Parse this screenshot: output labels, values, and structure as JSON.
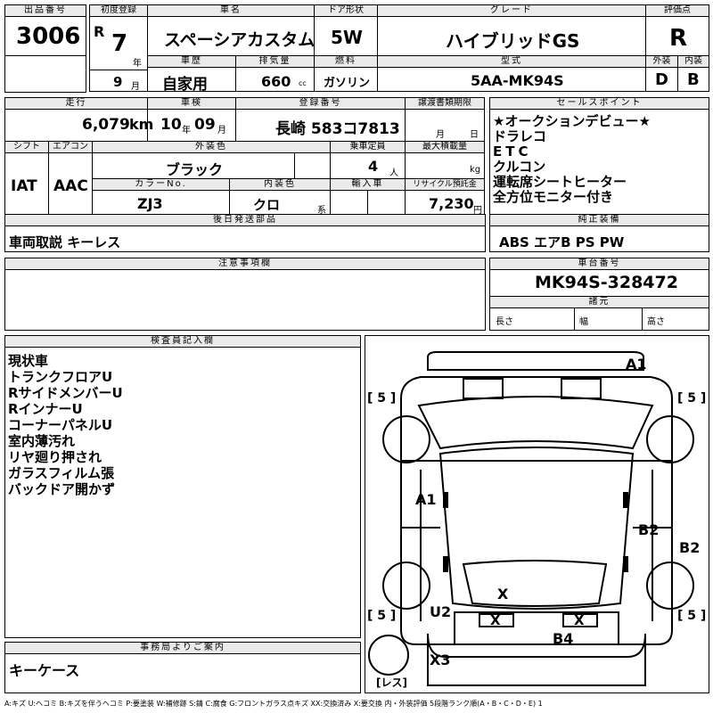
{
  "labels": {
    "lot": "出品番号",
    "first_reg": "初度登録",
    "car_name": "車名",
    "door": "ドア形状",
    "grade": "グレード",
    "score": "評価点",
    "history": "車歴",
    "displacement": "排気量",
    "fuel": "燃料",
    "model_type": "型式",
    "exterior": "外装",
    "interior": "内装",
    "mileage": "走行",
    "inspection": "車検",
    "registration": "登録番号",
    "transfer_deadline": "譲渡書類期限",
    "sales_points": "セールスポイント",
    "shift": "シフト",
    "aircon": "エアコン",
    "ext_color": "外装色",
    "capacity": "乗車定員",
    "max_load": "最大積載量",
    "color_no": "カラーNo.",
    "int_color": "内装色",
    "import": "輸入車",
    "recycle": "リサイクル預託金",
    "later_parts": "後日発送部品",
    "std_equipment": "純正装備",
    "caution": "注意事項欄",
    "chassis_no": "車台番号",
    "specs": "諸元",
    "length": "長さ",
    "width": "幅",
    "height": "高さ",
    "inspector": "検査員記入欄",
    "office": "事務局よりご案内"
  },
  "units": {
    "year": "年",
    "month": "月",
    "cc": "cc",
    "km": "km",
    "day": "日",
    "persons": "人",
    "kg": "kg",
    "kei": "系",
    "yen": "円"
  },
  "values": {
    "lot_number": "3006",
    "era": "R",
    "reg_year": "7",
    "reg_month": "9",
    "car_name": "スペーシアカスタム",
    "door": "5W",
    "grade": "ハイブリッドGS",
    "score": "R",
    "history": "自家用",
    "displacement": "660",
    "fuel": "ガソリン",
    "model_type": "5AA-MK94S",
    "exterior_score": "D",
    "interior_score": "B",
    "mileage": "6,079",
    "inspection_year": "10",
    "inspection_month": "09",
    "registration_number": "長崎 583コ7813",
    "shift": "IAT",
    "aircon": "AAC",
    "ext_color": "ブラック",
    "capacity": "4",
    "color_no": "ZJ3",
    "int_color": "クロ",
    "recycle_fee": "7,230",
    "later_parts": "車両取説 キーレス",
    "std_equipment": "ABS エアB PS PW",
    "chassis_number": "MK94S-328472"
  },
  "sales_points": [
    "★オークションデビュー★",
    "ドラレコ",
    "ETC",
    "クルコン",
    "運転席シートヒーター",
    "全方位モニター付き"
  ],
  "inspector_notes": [
    "現状車",
    "トランクフロアU",
    "RサイドメンバーU",
    "RインナーU",
    "コーナーパネルU",
    "室内薄汚れ",
    "リヤ廻り押され",
    "ガラスフィルム張",
    "バックドア開かず"
  ],
  "diagram": {
    "tire_tl": "[ 5 ]",
    "tire_tr": "[ 5 ]",
    "tire_bl": "[ 5 ]",
    "tire_br": "[ 5 ]",
    "spare": "[レス]",
    "marks": {
      "a1_top": "A1",
      "a1_left": "A1",
      "b2": "B2",
      "b2_side": "B2",
      "x_center": "X",
      "u2": "U2",
      "x_left": "X",
      "x_right": "X",
      "b4": "B4",
      "x3": "X3"
    }
  },
  "office_note": "キーケース",
  "legend": "A:キズ U:ヘコミ B:キズを伴うヘコミ P:要塗装 W:補修跡 S:錆 C:腐食 G:フロントガラス点キズ XX:交換済み X:要交換 内・外装評価 5段階ランク順(A・B・C・D・E) 1"
}
